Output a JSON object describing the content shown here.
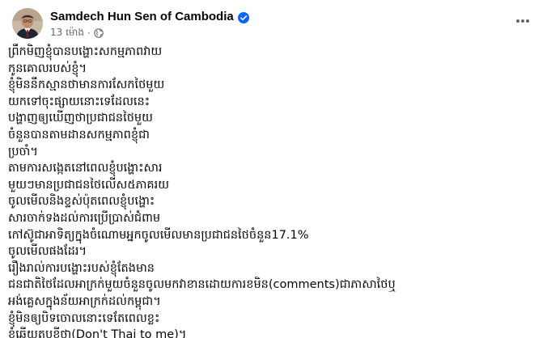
{
  "post": {
    "author": "Samdech Hun Sen of Cambodia",
    "timestamp": "13 ម៉ោង",
    "separator": "·",
    "icons": {
      "verified": "verified-badge-icon",
      "audience": "globe-icon",
      "more": "more-options-icon"
    },
    "colors": {
      "verified": "#0866ff",
      "meta_text": "#65676b"
    },
    "lines": [
      "ព្រឹកមិញខ្ញុំបានបង្ហោះសកម្មភាពវាយ",
      "កូនគោលរបស់ខ្ញុំ។",
      "ខ្ញុំមិននឹកស្មានថាមានការសែកថៃមួយ",
      "យកទៅចុះផ្សាយនោះទេដែលនេះ",
      "បង្ហាញឲ្យឃើញថាប្រជាជនថៃមួយ",
      "ចំនួនបានតាមដានសកម្មភាពខ្ញុំជា",
      "ប្រចាំ។",
      "តាមការសង្កេតនៅពេលខ្ញុំបង្ហោះសារ",
      "មួយៗមានប្រជាជនថៃលើស៥ភាគរយ",
      "ចូលមើលនិងខ្ទស់ប៉ុតពេលខ្ញុំបង្ហោះ",
      "សារចាក់ទងដល់ការប្រើប្រាស់ជំពាម",
      "កៅស៊ូជាអាទិត្យក្នុងចំណោមអ្នកចូលមើលមានប្រជាជនថៃចំនួន17.1%",
      "ចូលមើលផងដែរ។",
      "រឿងរាល់ការបង្ហោះរបស់ខ្ញុំតែងមាន",
      "ជនជាតិថៃដែលអាក្រក់មួយចំនួនចូលមកវាខានដោយការខមិន(comments)ជាភាសាថៃឬ",
      "អង់គ្លេសក្នុងន័យអាក្រក់ដល់កម្ពុជា។",
      "ខ្ញុំមិនឲ្យបិទចោលនោះទេតែពេលខ្លះ",
      "ខ្ញុំឆ្លើយតបខ្លីថា(Don't Thai to me)។"
    ]
  }
}
